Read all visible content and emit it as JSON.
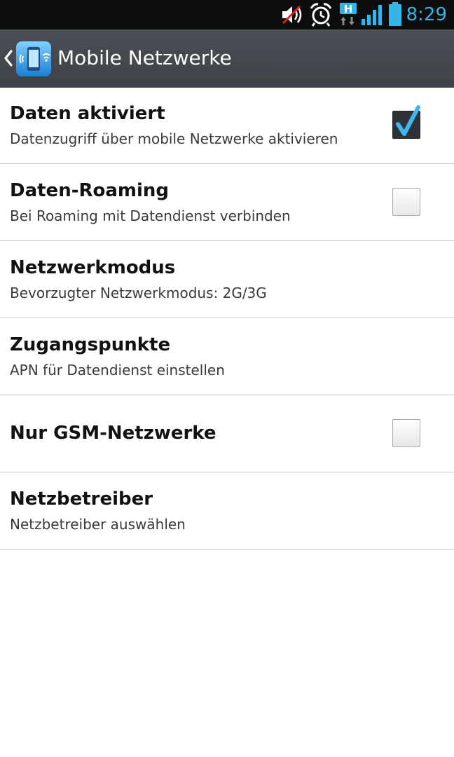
{
  "status_bar": {
    "time": "8:29",
    "icons": [
      "volume-muted-icon",
      "alarm-icon",
      "hspa-data-icon",
      "signal-strength-icon",
      "battery-icon"
    ],
    "hspa_letter": "H",
    "accent_color": "#33b5e5"
  },
  "action_bar": {
    "title": "Mobile Netzwerke",
    "back_icon": "chevron-left-icon",
    "app_icon": "mobile-networks-icon"
  },
  "settings": [
    {
      "title": "Daten aktiviert",
      "subtitle": "Datenzugriff über mobile Netzwerke aktivieren",
      "checkbox": true,
      "checked": true
    },
    {
      "title": "Daten-Roaming",
      "subtitle": "Bei Roaming mit Datendienst verbinden",
      "checkbox": true,
      "checked": false
    },
    {
      "title": "Netzwerkmodus",
      "subtitle": "Bevorzugter Netzwerkmodus: 2G/3G"
    },
    {
      "title": "Zugangspunkte",
      "subtitle": "APN für Datendienst einstellen"
    },
    {
      "title": "Nur GSM-Netzwerke",
      "checkbox": true,
      "checked": false
    },
    {
      "title": "Netzbetreiber",
      "subtitle": "Netzbetreiber auswählen"
    }
  ]
}
